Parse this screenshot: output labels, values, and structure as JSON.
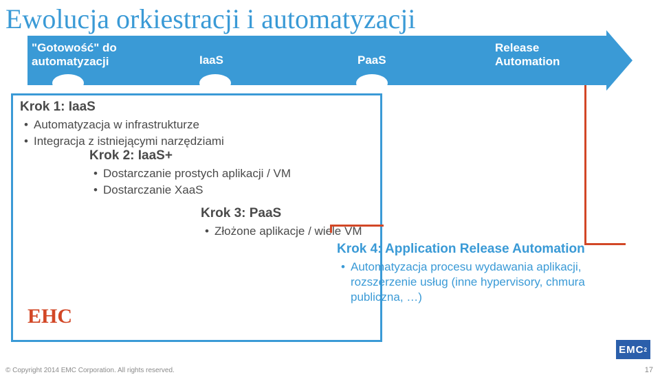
{
  "title": "Ewolucja orkiestracji i automatyzacji",
  "arrow": {
    "readiness_quoted": "Gotowość",
    "readiness_line2": "automatyzacji",
    "iaas": "IaaS",
    "paas": "PaaS",
    "ra_line1": "Release",
    "ra_line2": "Automation"
  },
  "step1": {
    "title": "Krok 1: IaaS",
    "b1": "Automatyzacja w infrastrukturze",
    "b2": "Integracja z istniejącymi narzędziami"
  },
  "step2": {
    "title": "Krok 2: IaaS+",
    "b1": "Dostarczanie prostych aplikacji / VM",
    "b2": "Dostarczanie XaaS"
  },
  "step3": {
    "title": "Krok 3: PaaS",
    "b1": "Złożone aplikacje / wiele VM"
  },
  "step4": {
    "title": "Krok 4: Application Release Automation",
    "b1": "Automatyzacja procesu wydawania aplikacji, rozszerzenie usług (inne hypervisory, chmura publiczna, …)"
  },
  "ehc": "EHC",
  "logo": "EMC",
  "logo_sup": "2",
  "copyright": "© Copyright 2014 EMC Corporation. All rights reserved.",
  "page": "17"
}
